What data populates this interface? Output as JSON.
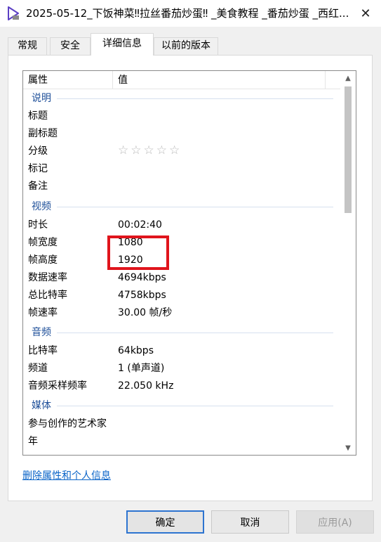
{
  "window": {
    "title": "2025-05-12_下饭神菜‼拉丝番茄炒蛋‼ _美食教程 _番茄炒蛋 _西红..."
  },
  "tabs": [
    {
      "label": "常规"
    },
    {
      "label": "安全"
    },
    {
      "label": "详细信息"
    },
    {
      "label": "以前的版本"
    }
  ],
  "list": {
    "col_property": "属性",
    "col_value": "值",
    "groups": {
      "description": "说明",
      "video": "视频",
      "audio": "音频",
      "media": "媒体"
    },
    "description": {
      "title": "标题",
      "subtitle": "副标题",
      "rating": "分级",
      "rating_value": 0,
      "rating_stars": "☆☆☆☆☆",
      "tags": "标记",
      "comments": "备注"
    },
    "video": {
      "duration_label": "时长",
      "duration_value": "00:02:40",
      "width_label": "帧宽度",
      "width_value": "1080",
      "height_label": "帧高度",
      "height_value": "1920",
      "datarate_label": "数据速率",
      "datarate_value": "4694kbps",
      "bitrate_label": "总比特率",
      "bitrate_value": "4758kbps",
      "framerate_label": "帧速率",
      "framerate_value": "30.00 帧/秒"
    },
    "audio": {
      "bitrate_label": "比特率",
      "bitrate_value": "64kbps",
      "channels_label": "频道",
      "channels_value": "1 (单声道)",
      "samplerate_label": "音频采样频率",
      "samplerate_value": "22.050 kHz"
    },
    "media": {
      "artists_label": "参与创作的艺术家",
      "year_label": "年"
    }
  },
  "remove_link": "删除属性和个人信息",
  "buttons": {
    "ok": "确定",
    "cancel": "取消",
    "apply": "应用(A)"
  },
  "colors": {
    "group_header": "#1e4f99",
    "highlight": "#e0141c",
    "link": "#0a64c8",
    "primary_border": "#2d74d0"
  }
}
